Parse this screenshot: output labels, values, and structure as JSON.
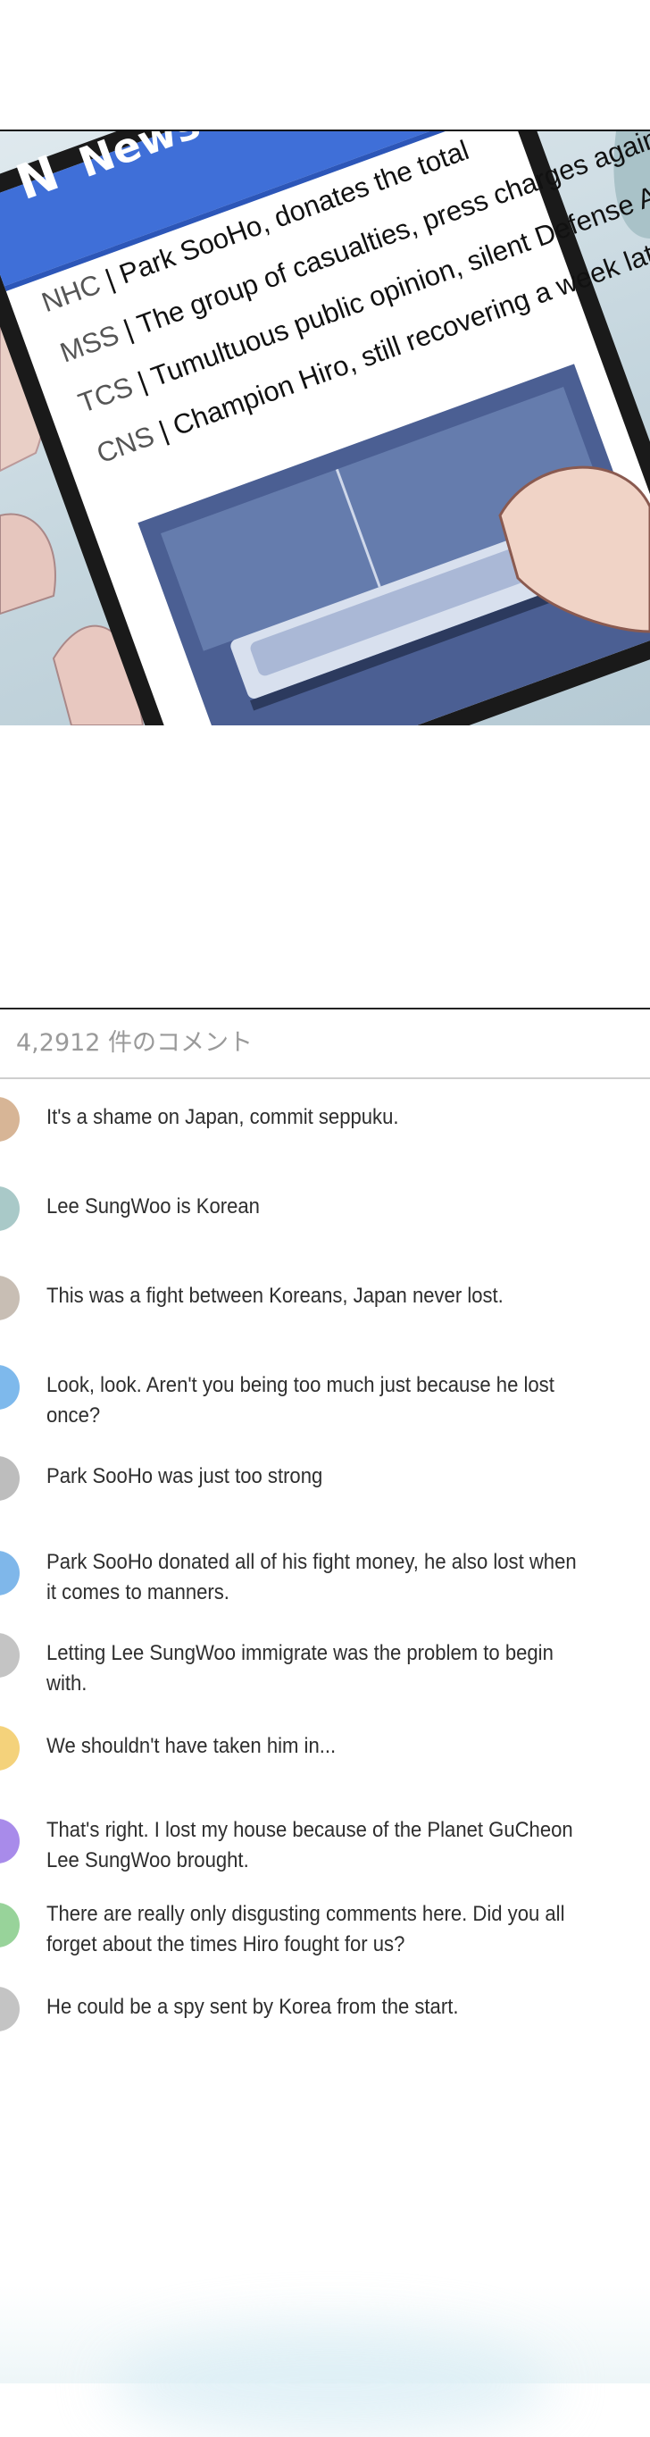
{
  "panel": {
    "app_title": "News",
    "app_logo": "N",
    "headlines": [
      {
        "source": "NHC",
        "text": "Park SooHo, donates the total"
      },
      {
        "source": "MSS",
        "text": "The group of casualties, press charges against Hiro"
      },
      {
        "source": "TCS",
        "text": "Tumultuous public opinion, silent Defense Agency"
      },
      {
        "source": "CNS",
        "text": "Champion Hiro, still recovering a week later"
      }
    ]
  },
  "comment_section": {
    "count_label": "4,2912 件のコメント",
    "comments": [
      {
        "text": "It's a shame on Japan, commit seppuku.",
        "avatar_color": "#d7b596"
      },
      {
        "text": "Lee SungWoo is Korean",
        "avatar_color": "#a9c9c8"
      },
      {
        "text": "This was a fight between Koreans, Japan never lost.",
        "avatar_color": "#c8beb4"
      },
      {
        "text": "Look, look. Aren't you being too much just because he lost once?",
        "avatar_color": "#7eb9ec"
      },
      {
        "text": "Park SooHo was just too strong",
        "avatar_color": "#bdbdbd"
      },
      {
        "text": "Park SooHo donated all of his fight money, he also lost when it comes to manners.",
        "avatar_color": "#7fb7ea"
      },
      {
        "text": "Letting Lee SungWoo immigrate was the problem to begin with.",
        "avatar_color": "#c4c4c4"
      },
      {
        "text": "We shouldn't have taken him in...",
        "avatar_color": "#f4d27b"
      },
      {
        "text": "That's right. I lost my house because of the Planet GuCheon Lee SungWoo brought.",
        "avatar_color": "#a88bea"
      },
      {
        "text": "There are really only disgusting comments here. Did you all forget about the times Hiro fought for us?",
        "avatar_color": "#98d39a"
      },
      {
        "text": "He could be a spy sent by Korea from the start.",
        "avatar_color": "#c4c4c4"
      }
    ]
  }
}
